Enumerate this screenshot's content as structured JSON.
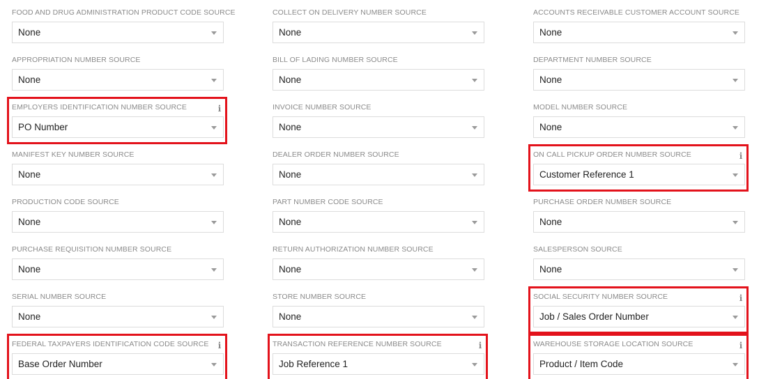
{
  "fields": [
    {
      "label": "FOOD AND DRUG ADMINISTRATION PRODUCT CODE SOURCE",
      "value": "None",
      "highlighted": false
    },
    {
      "label": "COLLECT ON DELIVERY NUMBER SOURCE",
      "value": "None",
      "highlighted": false
    },
    {
      "label": "ACCOUNTS RECEIVABLE CUSTOMER ACCOUNT SOURCE",
      "value": "None",
      "highlighted": false
    },
    {
      "label": "APPROPRIATION NUMBER SOURCE",
      "value": "None",
      "highlighted": false
    },
    {
      "label": "BILL OF LADING NUMBER SOURCE",
      "value": "None",
      "highlighted": false
    },
    {
      "label": "DEPARTMENT NUMBER SOURCE",
      "value": "None",
      "highlighted": false
    },
    {
      "label": "EMPLOYERS IDENTIFICATION NUMBER SOURCE",
      "value": "PO Number",
      "highlighted": true,
      "info": "i"
    },
    {
      "label": "INVOICE NUMBER SOURCE",
      "value": "None",
      "highlighted": false
    },
    {
      "label": "MODEL NUMBER SOURCE",
      "value": "None",
      "highlighted": false
    },
    {
      "label": "MANIFEST KEY NUMBER SOURCE",
      "value": "None",
      "highlighted": false
    },
    {
      "label": "DEALER ORDER NUMBER SOURCE",
      "value": "None",
      "highlighted": false
    },
    {
      "label": "ON CALL PICKUP ORDER NUMBER SOURCE",
      "value": "Customer Reference 1",
      "highlighted": true,
      "info": "i"
    },
    {
      "label": "PRODUCTION CODE SOURCE",
      "value": "None",
      "highlighted": false
    },
    {
      "label": "PART NUMBER CODE SOURCE",
      "value": "None",
      "highlighted": false
    },
    {
      "label": "PURCHASE ORDER NUMBER SOURCE",
      "value": "None",
      "highlighted": false
    },
    {
      "label": "PURCHASE REQUISITION NUMBER SOURCE",
      "value": "None",
      "highlighted": false
    },
    {
      "label": "RETURN AUTHORIZATION NUMBER SOURCE",
      "value": "None",
      "highlighted": false
    },
    {
      "label": "SALESPERSON SOURCE",
      "value": "None",
      "highlighted": false
    },
    {
      "label": "SERIAL NUMBER SOURCE",
      "value": "None",
      "highlighted": false
    },
    {
      "label": "STORE NUMBER SOURCE",
      "value": "None",
      "highlighted": false
    },
    {
      "label": "SOCIAL SECURITY NUMBER SOURCE",
      "value": "Job / Sales Order Number",
      "highlighted": true,
      "info": "i"
    },
    {
      "label": "FEDERAL TAXPAYERS IDENTIFICATION CODE SOURCE",
      "value": "Base Order Number",
      "highlighted": true,
      "info": "i"
    },
    {
      "label": "TRANSACTION REFERENCE NUMBER SOURCE",
      "value": "Job Reference 1",
      "highlighted": true,
      "info": "i"
    },
    {
      "label": "WAREHOUSE STORAGE LOCATION SOURCE",
      "value": "Product / Item Code",
      "highlighted": true,
      "info": "i"
    }
  ],
  "colors": {
    "highlight": "#e3121b",
    "label": "#8a8a8a",
    "border": "#dcdcdc",
    "value": "#222222"
  },
  "icons": {
    "dropdown": "chevron-down-icon",
    "info": "info-icon"
  }
}
